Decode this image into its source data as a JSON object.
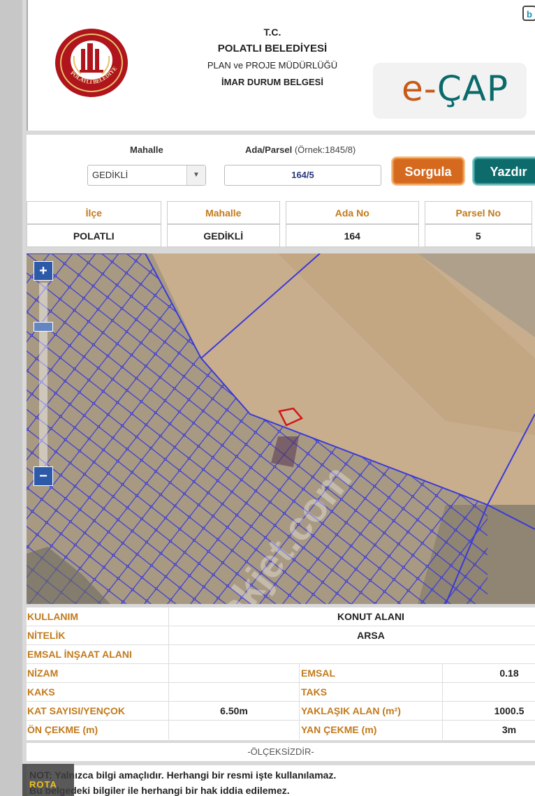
{
  "header": {
    "line1": "T.C.",
    "line2": "POLATLI BELEDİYESİ",
    "line3": "PLAN ve PROJE MÜDÜRLÜĞÜ",
    "line4": "İMAR DURUM BELGESİ",
    "seal_text": "POLATLI BELEDİYESİ",
    "brand_left": "e-",
    "brand_right": "ÇAP",
    "corner_badge": "b"
  },
  "query": {
    "mahalle_label": "Mahalle",
    "ada_parsel_label": "Ada/Parsel",
    "ada_parsel_hint": "(Örnek:1845/8)",
    "mahalle_value": "GEDİKLİ",
    "ada_parsel_value": "164/5",
    "sorgula_label": "Sorgula",
    "yazdir_label": "Yazdır"
  },
  "summary": {
    "headers": [
      "İlçe",
      "Mahalle",
      "Ada No",
      "Parsel No"
    ],
    "values": [
      "POLATLI",
      "GEDİKLİ",
      "164",
      "5"
    ]
  },
  "map": {
    "zoom_in": "+",
    "zoom_out": "−",
    "watermark": "emlakjet.com"
  },
  "details": {
    "kullanim_label": "KULLANIM",
    "kullanim_value": "KONUT ALANI",
    "nitelik_label": "NİTELİK",
    "nitelik_value": "ARSA",
    "emsal_insaat_label": "EMSAL İNŞAAT ALANI",
    "nizam_label": "NİZAM",
    "emsal_label": "EMSAL",
    "emsal_value": "0.18",
    "kaks_label": "KAKS",
    "taks_label": "TAKS",
    "kat_label": "KAT SAYISI/YENÇOK",
    "kat_value": "6.50m",
    "alan_label": "YAKLAŞIK ALAN (m²)",
    "alan_value": "1000.5",
    "on_cekme_label": "ÖN ÇEKME (m)",
    "yan_cekme_label": "YAN ÇEKME (m)",
    "yan_cekme_value": "3m",
    "scale_note": "-ÖLÇEKSİZDİR-"
  },
  "note": {
    "line1": "NOT: Yalnızca bilgi amaçlıdır. Herhangi bir resmi işte kullanılamaz.",
    "line2": "Bu belgedeki bilgiler ile herhangi bir hak iddia edilemez.",
    "rota_logo": "ROTA"
  },
  "colors": {
    "label_orange": "#c27a1c",
    "sorgula": "#d56a1f",
    "yazdir": "#0d6b6b",
    "parcel_line": "#3a3ad8",
    "selected_parcel": "#d01818"
  }
}
